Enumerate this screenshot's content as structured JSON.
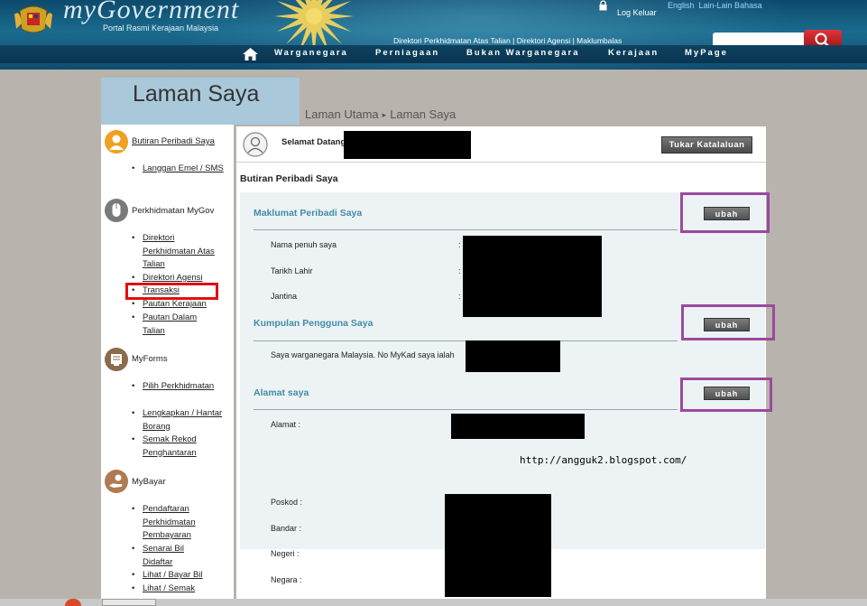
{
  "header": {
    "logo_text": "myGovernment",
    "portal_text": "Portal Rasmi Kerajaan Malaysia",
    "logout": "Log Keluar",
    "languages": [
      "English",
      "Lain-Lain Bahasa"
    ],
    "directory_links": "Direktori Perkhidmatan Atas Talian | Direktori Agensi | Maklumbalas",
    "search": {
      "value": ""
    },
    "nav": [
      "Warganegara",
      "Perniagaan",
      "Bukan Warganegara",
      "Kerajaan",
      "MyPage"
    ]
  },
  "page": {
    "title": "Laman Saya",
    "breadcrumb": [
      "Laman Utama",
      "Laman Saya"
    ],
    "breadcrumb_sep": "▸"
  },
  "sidebar": {
    "sections": [
      {
        "title": "Butiran Peribadi Saya",
        "items": [
          "Langgan Emel / SMS"
        ]
      },
      {
        "title": "Perkhidmatan MyGov",
        "items": [
          "Direktori Perkhidmatan Atas Talian",
          "Direktori Agensi",
          "Transaksi",
          "Pautan Kerajaan",
          "Pautan Dalam Talian"
        ]
      },
      {
        "title": "MyForms",
        "items": [
          "Pilih Perkhidmatan",
          "Lengkapkan / Hantar Borang",
          "Semak Rekod Penghantaran"
        ]
      },
      {
        "title": "MyBayar",
        "items": [
          "Pendaftaran Perkhidmatan Pembayaran",
          "Senarai Bil Didaftar",
          "Lihat / Bayar Bil",
          "Lihat / Semak"
        ]
      }
    ],
    "bullet": "•"
  },
  "main": {
    "welcome": "Selamat Datang",
    "change_password": "Tukar Katalaluan",
    "section_title": "Butiran Peribadi Saya",
    "edit_label": "ubah",
    "personal": {
      "title": "Maklumat Peribadi Saya",
      "fields": [
        "Nama penuh saya",
        "Tarikh Lahir",
        "Jantina"
      ],
      "colon": ":"
    },
    "group": {
      "title": "Kumpulan Pengguna Saya",
      "text": "Saya warganegara Malaysia. No MyKad saya ialah"
    },
    "address": {
      "title": "Alamat saya",
      "alamat": "Alamat :",
      "poskod": "Poskod :",
      "bandar": "Bandar :",
      "negeri": "Negeri :",
      "negara": "Negara :"
    },
    "watermark_url": "http://angguk2.blogspot.com/"
  },
  "colors": {
    "header_blue": "#1a6b8e",
    "accent_teal": "#3f8da6",
    "highlight_red": "#e01010",
    "highlight_purple": "#9a4a9e"
  }
}
